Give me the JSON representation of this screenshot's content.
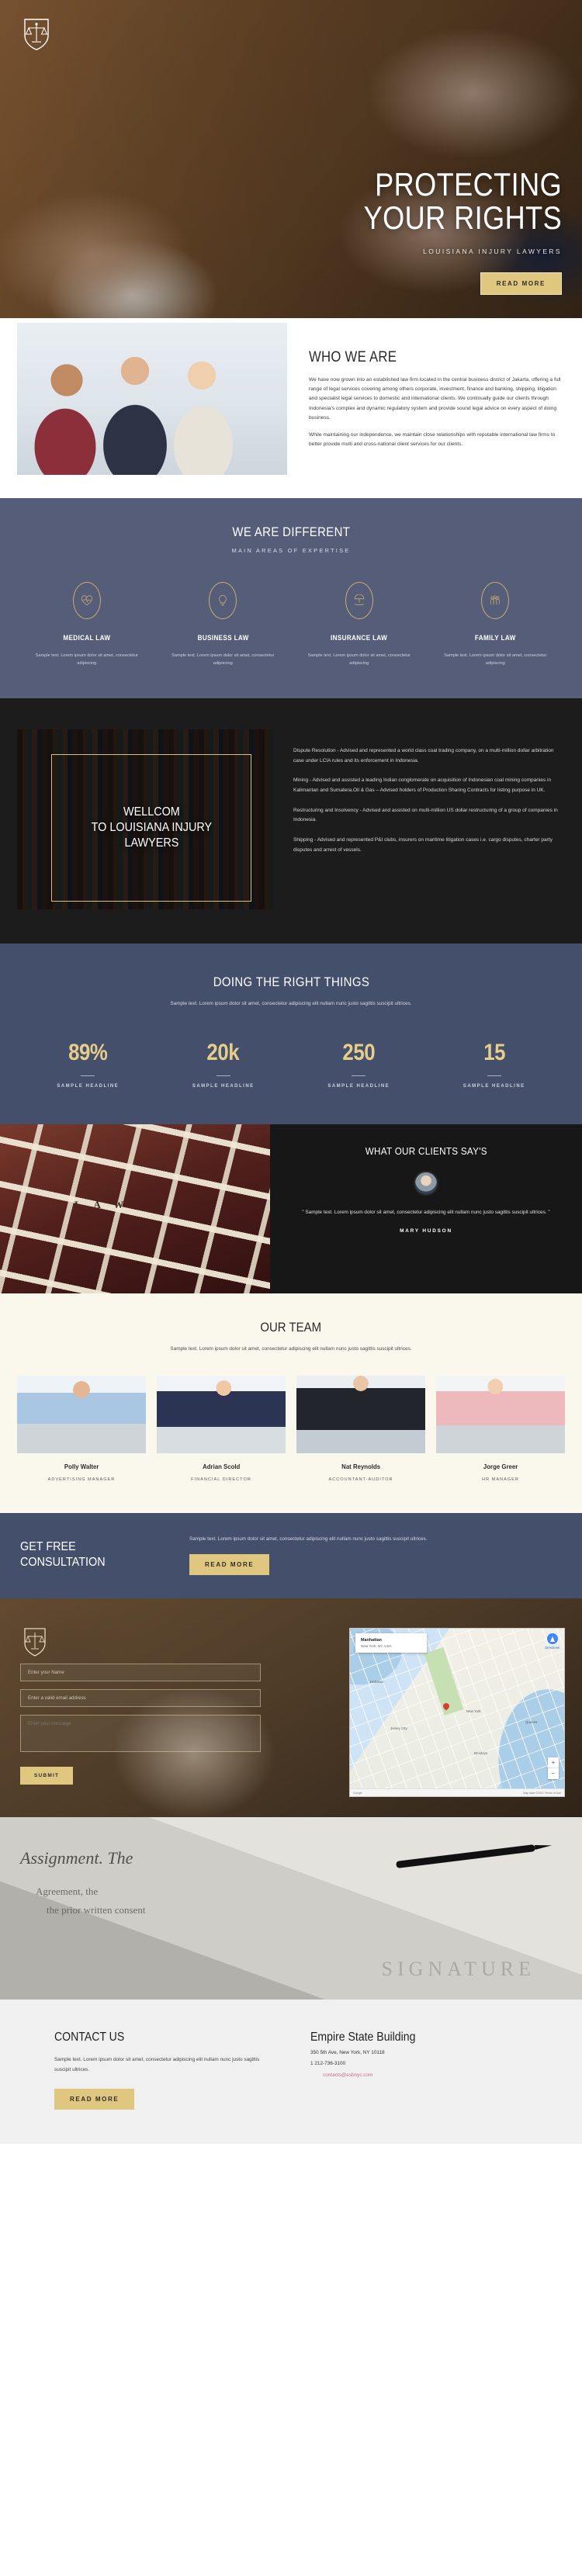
{
  "hero": {
    "logo_icon": "scales-of-justice-shield-icon",
    "title_line1": "PROTECTING",
    "title_line2": "YOUR RIGHTS",
    "subtitle": "LOUISIANA INJURY LAWYERS",
    "cta": "READ MORE"
  },
  "who": {
    "title": "WHO WE ARE",
    "paragraph1": "We have now grown into an established law firm located in the central business district of Jakarta, offering a full range of legal services covering among others corporate, investment, finance and banking, shipping, litigation and specialist legal services to domestic and international clients. We continually guide our clients through Indonesia's complex and dynamic regulatory system and provide sound legal advice on every aspect of doing business.",
    "paragraph2": "While maintaining our independence, we maintain close relationships with reputable international law firms to better provide multi and cross-national client services for our clients."
  },
  "different": {
    "title": "WE ARE DIFFERENT",
    "subtitle": "MAIN AREAS OF EXPERTISE",
    "cards": [
      {
        "icon": "heartbeat-icon",
        "title": "MEDICAL LAW",
        "text": "Sample text. Lorem ipsum dolor sit amet, consectetur adipiscing"
      },
      {
        "icon": "lightbulb-icon",
        "title": "BUSINESS LAW",
        "text": "Sample text. Lorem ipsum dolor sit amet, consectetur adipiscing"
      },
      {
        "icon": "hand-umbrella-icon",
        "title": "INSURANCE LAW",
        "text": "Sample text. Lorem ipsum dolor sit amet, consectetur adipiscing"
      },
      {
        "icon": "family-group-icon",
        "title": "FAMILY LAW",
        "text": "Sample text. Lorem ipsum dolor sit amet, consectetur adipiscing"
      }
    ]
  },
  "wellcom": {
    "overlay_line1": "WELLCOM",
    "overlay_line2": "TO LOUISIANA INJURY",
    "overlay_line3": "LAWYERS",
    "paragraphs": [
      "Dispute Resolution - Advised and represented a world class coal trading company, on a multi-million dollar arbitration case under LCIA rules and its enforcement in Indonesia.",
      "Mining - Advised and assisted a leading Indian conglomerate on acquisition of Indonesian coal mining companies in Kalimantan and Sumatera.Oil & Gas – Advised holders of Production Sharing Contracts for listing purpose in UK.",
      "Restructuring and Insolvency - Advised and assisted on multi-million US dollar restructuring of a group of companies in Indonesia.",
      "Shipping - Advised and represented P&I clubs, insurers on maritime litigation cases i.e. cargo disputes, charter party disputes and arrest of vessels."
    ]
  },
  "stats": {
    "title": "DOING THE RIGHT THINGS",
    "text": "Sample text. Lorem ipsum dolor sit amet, consectetur adipiscing elit nullam nunc justo sagittis suscipit ultrices.",
    "items": [
      {
        "number": "89%",
        "label": "SAMPLE HEADLINE"
      },
      {
        "number": "20k",
        "label": "SAMPLE HEADLINE"
      },
      {
        "number": "250",
        "label": "SAMPLE HEADLINE"
      },
      {
        "number": "15",
        "label": "SAMPLE HEADLINE"
      }
    ]
  },
  "testimonial": {
    "image_word": "L A W",
    "title": "WHAT OUR CLIENTS SAY'S",
    "quote": "\" Sample text. Lorem ipsum dolor sit amet, consectetur adipiscing elit nullam nunc justo sagittis suscipit ultrices. \"",
    "author": "MARY HUDSON"
  },
  "team": {
    "title": "OUR TEAM",
    "text": "Sample text. Lorem ipsum dolor sit amet, consectetur adipiscing elit nullam nunc justo sagittis suscipit ultrices.",
    "members": [
      {
        "name": "Polly Walter",
        "role": "ADVERTISING MANAGER"
      },
      {
        "name": "Adrian Scold",
        "role": "FINANCIAL DIRECTOR"
      },
      {
        "name": "Nat Reynolds",
        "role": "ACCOUNTANT-AUDITOR"
      },
      {
        "name": "Jorge Greer",
        "role": "HR MANAGER"
      }
    ]
  },
  "consultation": {
    "title_line1": "GET FREE",
    "title_line2": "CONSULTATION",
    "text": "Sample text. Lorem ipsum dolor sit amet, consectetur adipiscing elit nullam nunc justo sagittis suscipit ultrices.",
    "cta": "READ MORE"
  },
  "form": {
    "logo_icon": "scales-of-justice-shield-icon",
    "name_placeholder": "Enter your Name",
    "email_placeholder": "Enter a valid email address",
    "message_placeholder": "Enter your message",
    "submit": "SUBMIT"
  },
  "map": {
    "card_title": "Manhattan",
    "card_subtitle": "New York, NY, USA",
    "directions_label": "Directions",
    "labels": [
      "Hoboken",
      "New York",
      "Jersey City",
      "Brooklyn",
      "Queens"
    ],
    "zoom_in": "+",
    "zoom_out": "−",
    "attribution_left": "Google",
    "attribution_right": "Map data ©2021  Terms of Use"
  },
  "signature_banner": {
    "text1": "Assignment. The",
    "text2": "Agreement, the",
    "text3": "the prior written consent",
    "text4": "SIGNATURE"
  },
  "footer": {
    "contact_title": "CONTACT US",
    "contact_text": "Sample text. Lorem ipsum dolor sit amet, consectetur adipiscing elit nullam nunc justo sagittis suscipit ultrices.",
    "contact_cta": "READ MORE",
    "address_title": "Empire State Building",
    "address_line": "350 5th Ave, New York, NY 10118",
    "phone": "1 212-736-3100",
    "email": "contacts@esbnyc.com"
  },
  "colors": {
    "gold": "#e0c77f",
    "slate": "#555d79",
    "navy": "#434f6b",
    "dark": "#1c1c1c",
    "cream": "#faf7ec",
    "pink_link": "#d16a8e"
  }
}
